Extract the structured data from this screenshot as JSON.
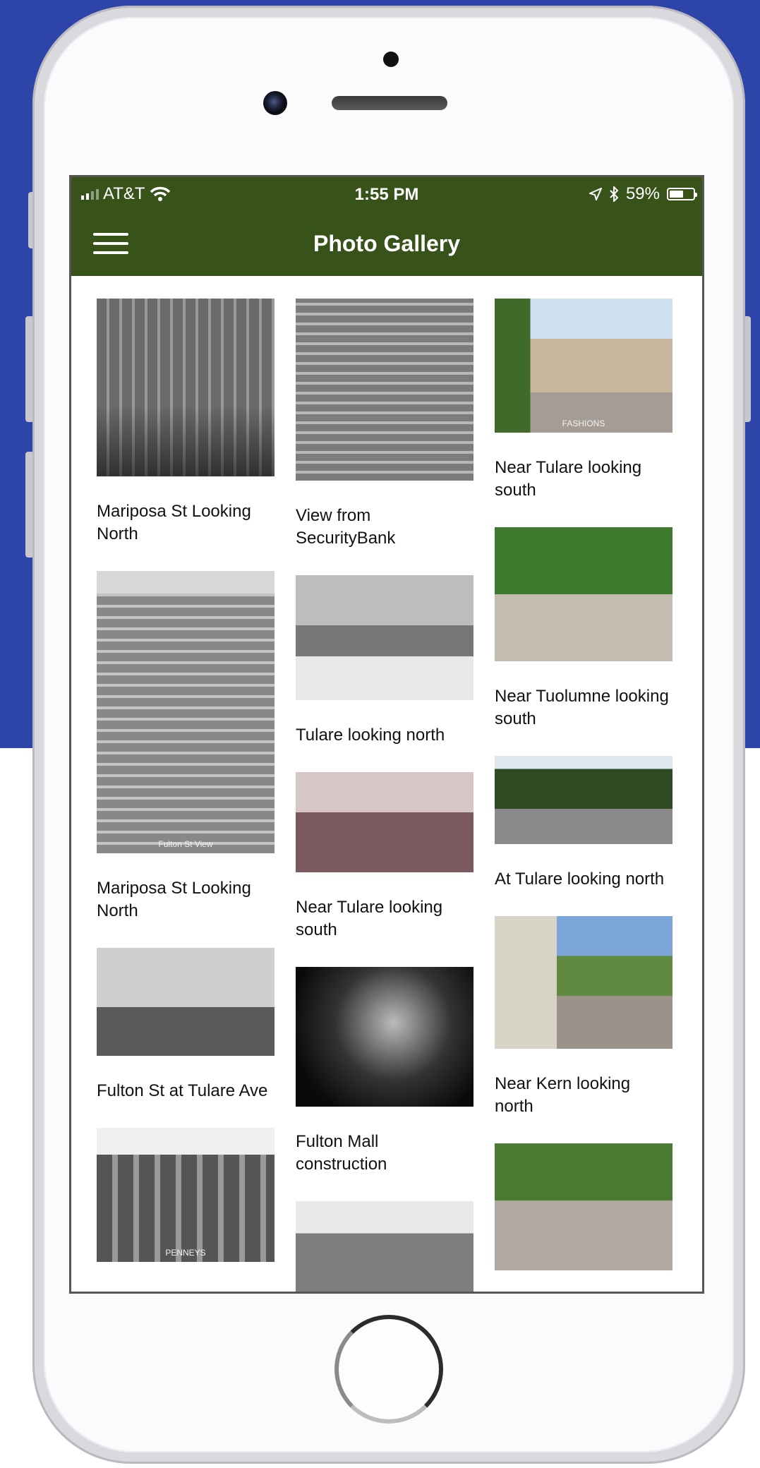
{
  "status_bar": {
    "carrier": "AT&T",
    "time": "1:55 PM",
    "battery_percent": "59%",
    "battery_level": 0.59
  },
  "nav": {
    "title": "Photo Gallery"
  },
  "gallery": {
    "columns": [
      [
        {
          "caption": "Mariposa St Looking North",
          "photo_height": 252,
          "photo_class": "bw1",
          "photo_icon": "photo-street-icon"
        },
        {
          "caption": "Mariposa St Looking North",
          "photo_height": 400,
          "photo_class": "bw3",
          "photo_icon": "photo-aerial-icon",
          "printed_text": "Fulton St View"
        },
        {
          "caption": "Fulton St at Tulare Ave",
          "photo_height": 153,
          "photo_class": "bw4",
          "photo_icon": "photo-streetcar-icon"
        },
        {
          "caption": "",
          "photo_height": 190,
          "photo_class": "bw5",
          "photo_icon": "photo-parade-icon",
          "printed_text": "PENNEYS"
        }
      ],
      [
        {
          "caption": "View from SecurityBank",
          "photo_height": 258,
          "photo_class": "bw2",
          "photo_icon": "photo-aerial-icon"
        },
        {
          "caption": "Tulare looking north",
          "photo_height": 177,
          "photo_class": "bw6",
          "photo_icon": "photo-intersection-icon"
        },
        {
          "caption": "Near Tulare looking south",
          "photo_height": 142,
          "photo_class": "c1",
          "photo_icon": "photo-traffic-icon"
        },
        {
          "caption": "Fulton Mall construction",
          "photo_height": 198,
          "photo_class": "bw7",
          "photo_icon": "photo-night-icon"
        },
        {
          "caption": "",
          "photo_height": 130,
          "photo_class": "bw8",
          "photo_icon": "photo-street-icon"
        }
      ],
      [
        {
          "caption": "Near Tulare looking south",
          "photo_height": 190,
          "photo_class": "c2",
          "photo_icon": "photo-storefront-icon",
          "printed_text": "FASHIONS"
        },
        {
          "caption": "Near Tuolumne looking south",
          "photo_height": 190,
          "photo_class": "c3",
          "photo_icon": "photo-fountain-icon"
        },
        {
          "caption": "At Tulare looking north",
          "photo_height": 125,
          "photo_class": "c4",
          "photo_icon": "photo-trees-icon"
        },
        {
          "caption": "Near Kern looking north",
          "photo_height": 188,
          "photo_class": "c5",
          "photo_icon": "photo-plaza-icon"
        },
        {
          "caption": "",
          "photo_height": 180,
          "photo_class": "c6",
          "photo_icon": "photo-mall-icon"
        }
      ]
    ]
  }
}
